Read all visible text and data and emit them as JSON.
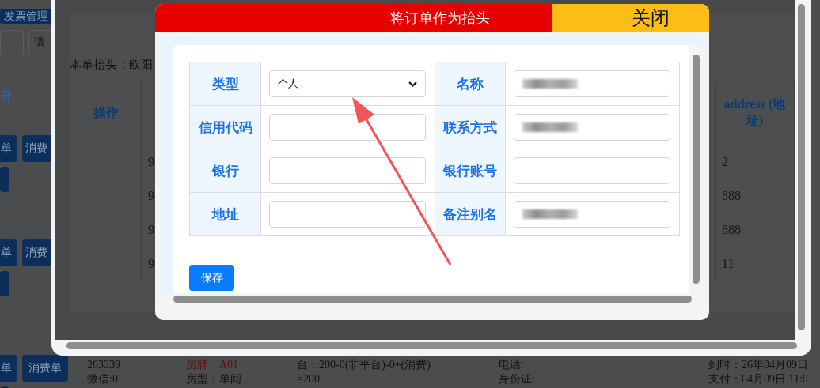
{
  "background": {
    "top_button": "发票管理",
    "select_partial": "请",
    "column_header_partial": "开",
    "action_rows": [
      {
        "buttons": [
          "单",
          "消费"
        ]
      },
      {
        "buttons": [
          "单",
          "消费"
        ]
      },
      {
        "buttons": [
          "单",
          "消费单"
        ]
      }
    ],
    "info_columns": [
      {
        "lines": [
          "263339",
          "微信:0"
        ],
        "kind": "plain"
      },
      {
        "lines": [
          "房牌：A01",
          "房型：单间"
        ],
        "kind": "highlight"
      },
      {
        "lines": [
          "台：200-0(非平台)-0+(消费)",
          "=200"
        ],
        "kind": "plain"
      },
      {
        "lines": [
          "电话:",
          "身份证:"
        ],
        "kind": "plain"
      },
      {
        "lines": [
          "到时：26年04月09日",
          "支付：04月09日 11:0"
        ],
        "kind": "plain"
      }
    ]
  },
  "window": {
    "header_label": "本单抬头：欧阳",
    "table": {
      "columns": [
        "操作",
        "address (地址)"
      ],
      "rows": [
        {
          "column_2": "9",
          "address": "2"
        },
        {
          "column_2": "9",
          "address": "888"
        },
        {
          "column_2": "9",
          "address": "888"
        },
        {
          "column_2": "9",
          "address": "11"
        }
      ]
    }
  },
  "modal": {
    "title": "将订单作为抬头",
    "close": "关闭",
    "fields": [
      {
        "label": "类型",
        "kind": "select",
        "value": "个人"
      },
      {
        "label": "名称",
        "kind": "input",
        "blurred": true
      },
      {
        "label": "信用代码",
        "kind": "input",
        "blurred": false
      },
      {
        "label": "联系方式",
        "kind": "input",
        "blurred": true
      },
      {
        "label": "银行",
        "kind": "input",
        "blurred": false
      },
      {
        "label": "银行账号",
        "kind": "input",
        "blurred": false
      },
      {
        "label": "地址",
        "kind": "input",
        "blurred": false
      },
      {
        "label": "备注别名",
        "kind": "input",
        "blurred": true
      }
    ],
    "save": "保存"
  }
}
